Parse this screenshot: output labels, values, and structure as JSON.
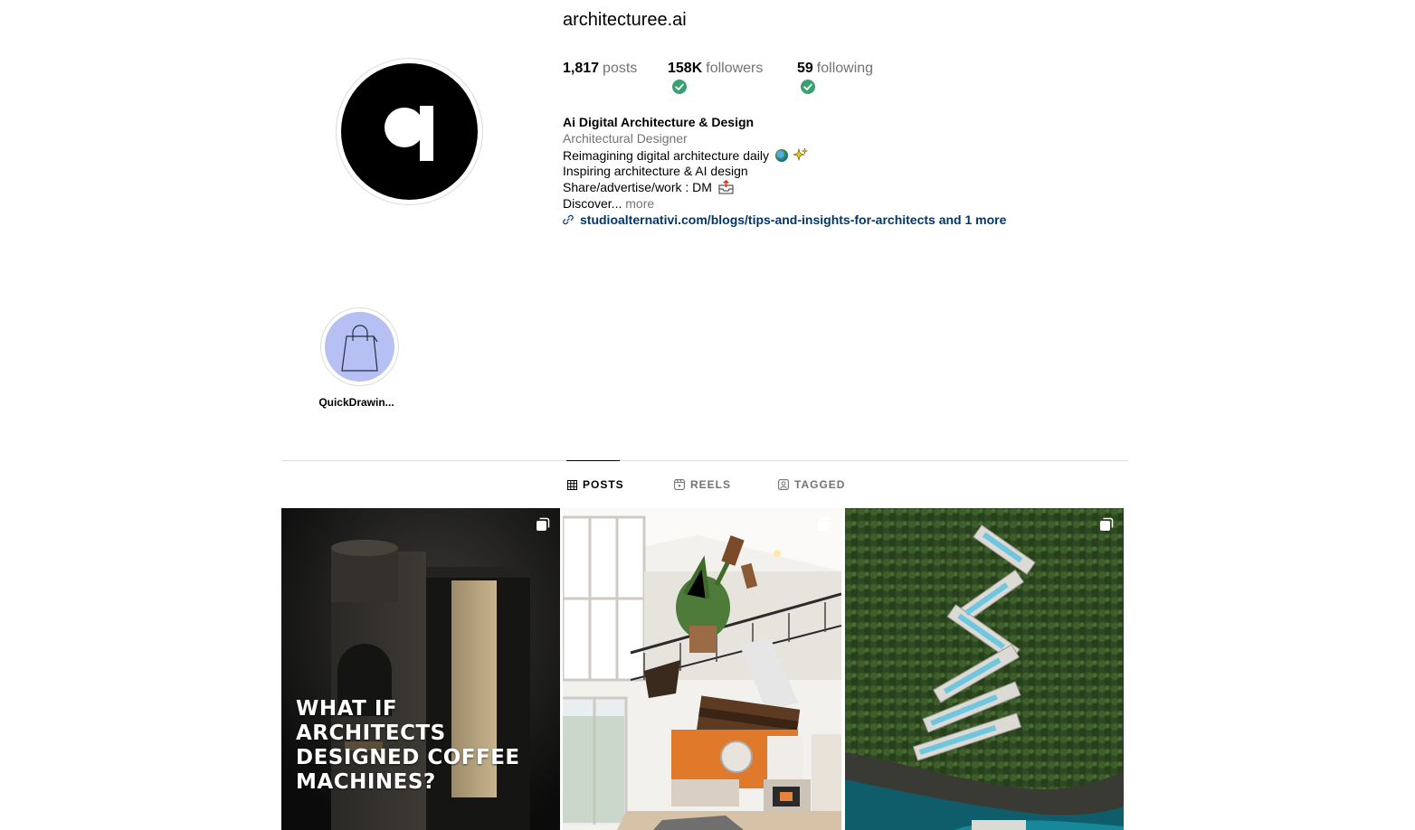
{
  "profile": {
    "username": "architecturee.ai",
    "stats": {
      "posts_count": "1,817",
      "posts_label": "posts",
      "followers_count": "158K",
      "followers_label": "followers",
      "following_count": "59",
      "following_label": "following"
    },
    "full_name": "Ai Digital Architecture & Design",
    "category": "Architectural Designer",
    "bio": {
      "line1": "Reimagining digital architecture daily",
      "line2": "Inspiring architecture & AI design",
      "line3": "Share/advertise/work : DM",
      "line4": "Discover...",
      "more": "more"
    },
    "link": "studioalternativi.com/blogs/tips-and-insights-for-architects and 1 more"
  },
  "highlights": [
    {
      "label": "QuickDrawin...",
      "icon": "shopping-bag-icon",
      "color": "#b7c0f3"
    }
  ],
  "tabs": [
    {
      "label": "POSTS",
      "icon": "grid-icon",
      "active": true
    },
    {
      "label": "REELS",
      "icon": "reels-icon",
      "active": false
    },
    {
      "label": "TAGGED",
      "icon": "tagged-icon",
      "active": false
    }
  ],
  "posts": [
    {
      "caption": "What if architects designed coffee machines?",
      "icon": "multiple-posts-icon"
    },
    {
      "caption": "",
      "icon": "multiple-posts-icon"
    },
    {
      "caption": "",
      "icon": "multiple-posts-icon"
    }
  ],
  "colors": {
    "link": "#00376b",
    "secondary_text": "#737373",
    "verified_check": "#3a9f73",
    "divider": "#dbdbdb"
  }
}
